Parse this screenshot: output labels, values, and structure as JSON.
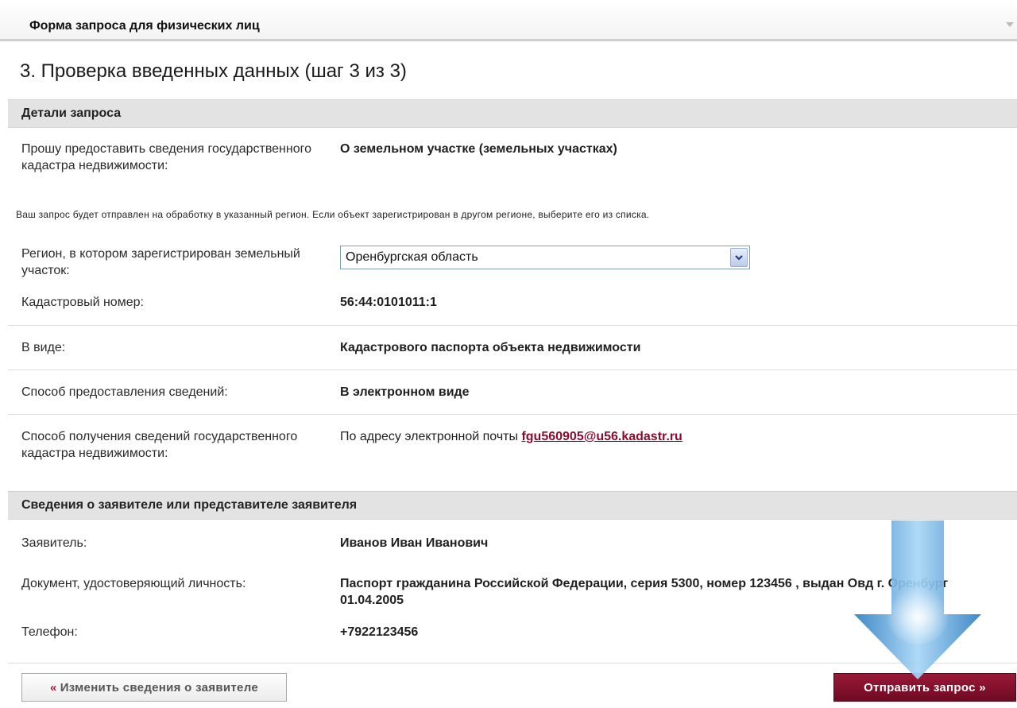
{
  "form_header": "Форма запроса для физических лиц",
  "step_title": "3. Проверка введенных данных (шаг 3 из 3)",
  "request_details": {
    "section_title": "Детали запроса",
    "info_requested_label": "Прошу предоставить сведения государственного кадастра недвижимости:",
    "info_requested_value": "О земельном участке (земельных участках)",
    "region_note": "Ваш запрос будет отправлен на обработку в указанный регион. Если объект зарегистрирован в другом регионе, выберите его из списка.",
    "region_label": "Регион, в котором зарегистрирован земельный участок:",
    "region_value": "Оренбургская область",
    "cadastral_label": "Кадастровый номер:",
    "cadastral_value": "56:44:0101011:1",
    "form_label": "В виде:",
    "form_value": "Кадастрового паспорта объекта недвижимости",
    "delivery_method_label": "Способ предоставления сведений:",
    "delivery_method_value": "В электронном виде",
    "receipt_method_label": "Способ получения сведений государственного кадастра недвижимости:",
    "receipt_method_prefix": "По адресу электронной почты",
    "receipt_email": "fgu560905@u56.kadastr.ru"
  },
  "applicant": {
    "section_title": "Сведения о заявителе или представителе заявителя",
    "name_label": "Заявитель:",
    "name_value": "Иванов Иван Иванович",
    "id_doc_label": "Документ, удостоверяющий личность:",
    "id_doc_value": "Паспорт гражданина Российской Федерации, серия 5300, номер 123456 , выдан Овд г. Оренбург 01.04.2005",
    "phone_label": "Телефон:",
    "phone_value": "+7922123456"
  },
  "buttons": {
    "back_quote": "«",
    "back_label": "Изменить сведения о заявителе",
    "send_label": "Отправить запрос »"
  },
  "colors": {
    "accent": "#8a0b2d",
    "section_bg": "#e3e3e3",
    "arrow": "#5aa6dc"
  }
}
